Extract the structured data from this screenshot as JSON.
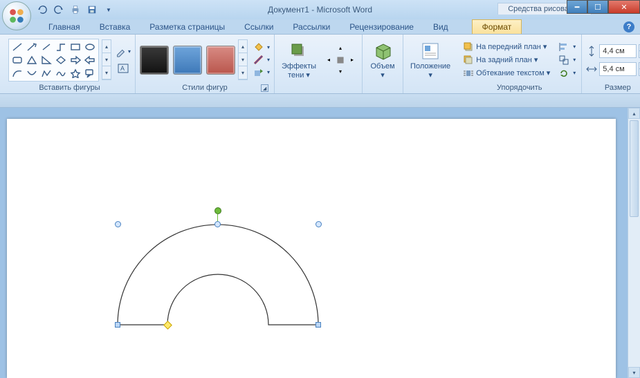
{
  "title": "Документ1 - Microsoft Word",
  "context_tool_label": "Средства рисования",
  "tabs": {
    "home": "Главная",
    "insert": "Вставка",
    "layout": "Разметка страницы",
    "refs": "Ссылки",
    "mail": "Рассылки",
    "review": "Рецензирование",
    "view": "Вид",
    "format": "Формат"
  },
  "groups": {
    "shapes": "Вставить фигуры",
    "styles": "Стили фигур",
    "effects": "Эффекты тени ▾",
    "volume": "Объем ▾",
    "position": "Положение ▾",
    "arrange": "Упорядочить",
    "size": "Размер"
  },
  "arrange": {
    "front": "На передний план ▾",
    "back": "На задний план ▾",
    "wrap": "Обтекание текстом ▾"
  },
  "size": {
    "height": "4,4 см",
    "width": "5,4 см"
  }
}
